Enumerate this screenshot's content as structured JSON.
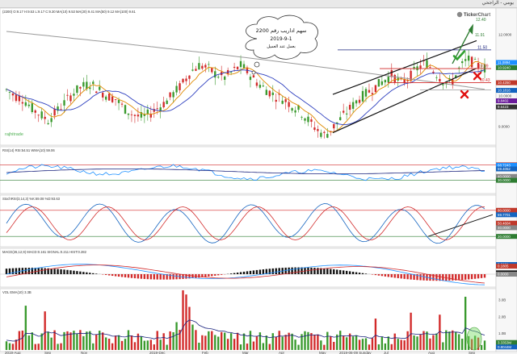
{
  "app": {
    "window_title_right": "يومي - الراجحي",
    "logo_text": "TickerChart",
    "watermark": "rajhitrade"
  },
  "legends": {
    "price": "(2200) O:9.17 H:9.53 L:9.17 C:9.30 MA(10) 9.53 MA(20) 9.41 MA(50) 9.12 MA(100) 9.61",
    "rsi": "RSI(14) RSI:54.51 WMA(10) 59.06",
    "stoch": "StochRSI(3,14,3) %K:69.08 %D:93.63",
    "macd": "MACD(26,12,9) MACD:0.161 SIGNAL:0.211 HIST:0.282",
    "vol": "VOL EMA(10) 3.3B"
  },
  "note": {
    "line1": "سهم اداريب رقم 2200",
    "line2": "2019-9-1",
    "line3": "بعمل عند العميل"
  },
  "price_levels": [
    "12.40",
    "11.91",
    "11.50",
    "10.89",
    "10.43"
  ],
  "price_axis_badges": [
    {
      "label": "11.0894",
      "color": "#1e90ff"
    },
    {
      "label": "10.9240",
      "color": "#2e7d32"
    },
    {
      "label": "10.4250",
      "color": "#c0392b"
    },
    {
      "label": "10.1816",
      "color": "#1565c0"
    },
    {
      "label": "9.8402",
      "color": "#6a1b9a"
    },
    {
      "label": "9.6423",
      "color": "#333333"
    }
  ],
  "price_axis_ticks": [
    "12.0000",
    "11.0000",
    "10.0000",
    "9.0000",
    "8.0000"
  ],
  "rsi_axis": [
    {
      "label": "70.0000",
      "color": "#c0392b"
    },
    {
      "label": "68.7243",
      "color": "#1e90ff"
    },
    {
      "label": "59.4052",
      "color": "#1565c0"
    },
    {
      "label": "40.0000",
      "color": "#888888"
    },
    {
      "label": "30.0000",
      "color": "#2e7d32"
    }
  ],
  "stoch_axis": [
    {
      "label": "80.0000",
      "color": "#c0392b"
    },
    {
      "label": "69.7701",
      "color": "#1565c0"
    },
    {
      "label": "50.4604",
      "color": "#c0392b"
    },
    {
      "label": "40.0000",
      "color": "#888888"
    },
    {
      "label": "20.0000",
      "color": "#2e7d32"
    }
  ],
  "macd_axis": [
    {
      "label": "0.2181",
      "color": "#1565c0"
    },
    {
      "label": "0.1805",
      "color": "#c0392b"
    },
    {
      "label": "0.0325",
      "color": "#111111"
    },
    {
      "label": "0.0000",
      "color": "#888888"
    }
  ],
  "vol_axis": [
    {
      "label": "3.0B",
      "color": "#444444"
    },
    {
      "label": "2.0B",
      "color": "#444444"
    },
    {
      "label": "1.0B",
      "color": "#444444"
    },
    {
      "label": "3.3353M",
      "color": "#2e7d32"
    },
    {
      "label": "0.8044M",
      "color": "#1565c0"
    }
  ],
  "x_axis_labels": [
    "2019-Aug",
    "Sep",
    "Nov",
    "2019-Dec",
    "Feb",
    "Mar",
    "Apr",
    "May",
    "2019-06-09 Sunday",
    "Jul",
    "Aug",
    "Sep"
  ],
  "chart_data": {
    "type": "line",
    "title": "",
    "ylim": [
      8.5,
      12.6
    ],
    "series": [
      {
        "values": [
          10.2,
          10.0,
          9.9,
          9.6,
          9.4,
          9.2,
          9.5,
          9.8,
          10.1,
          10.3,
          10.4,
          10.2,
          10.0,
          9.9,
          9.6,
          9.4,
          9.3,
          9.4,
          9.6,
          9.8,
          10.1,
          10.4,
          10.8,
          11.0,
          10.9,
          10.7,
          10.6,
          10.8,
          11.0,
          10.7,
          10.4,
          10.2,
          10.0,
          9.9,
          9.7,
          9.5,
          9.2,
          8.9,
          8.7,
          9.0,
          9.3,
          9.6,
          9.9,
          10.1,
          10.3,
          10.5,
          10.7,
          10.4,
          10.6,
          10.9,
          11.1,
          10.8,
          10.5,
          10.4,
          10.9,
          11.2,
          11.0,
          10.9
        ]
      }
    ],
    "annotations": [
      "12.40",
      "11.91",
      "11.50",
      "10.89",
      "10.43"
    ]
  }
}
